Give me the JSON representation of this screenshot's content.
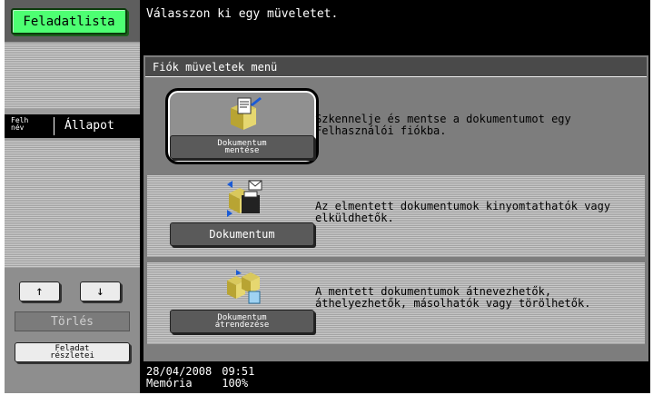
{
  "left_panel": {
    "task_list_button": "Feladatlista",
    "header_user_name": "Felh név",
    "header_status": "Állapot",
    "scroll_up": "↑",
    "scroll_down": "↓",
    "delete_button": "Törlés",
    "job_details_button": "Feladat részletei"
  },
  "message": "Válasszon ki egy müveletet.",
  "dialog": {
    "title": "Fiók müveletek menü",
    "options": [
      {
        "button_label": "Dokumentum mentése",
        "description_line1": "Szkennelje és mentse a dokumentumot egy",
        "description_line2": "Felhasználói fiókba.",
        "icon": "save-to-box-icon",
        "selected": true
      },
      {
        "button_label": "Dokumentum",
        "description_line1": "Az elmentett dokumentumok kinyomtathatók vagy",
        "description_line2": "elküldhetők.",
        "icon": "print-send-icon",
        "selected": false
      },
      {
        "button_label": "Dokumentum átrendezése",
        "description_line1": "A mentett dokumentumok átnevezhetők,",
        "description_line2": "áthelyezhetők, másolhatók vagy törölhetők.",
        "icon": "organize-documents-icon",
        "selected": false
      }
    ]
  },
  "status_bar": {
    "date": "28/04/2008",
    "time": "09:51",
    "memory_label": "Memória",
    "memory_value": "100%"
  },
  "colors": {
    "accent_green": "#4dff72",
    "dialog_grey": "#7d7d7d",
    "button_dark": "#5a5a5a"
  }
}
